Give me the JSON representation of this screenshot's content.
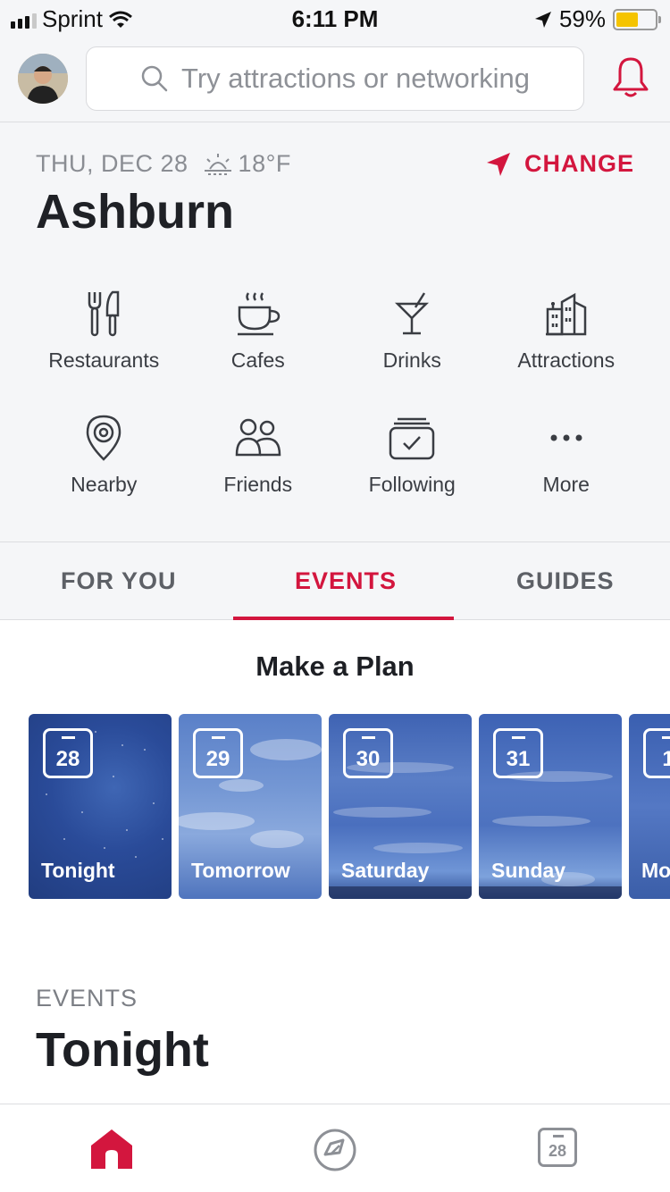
{
  "status_bar": {
    "carrier": "Sprint",
    "time": "6:11 PM",
    "battery": "59%",
    "battery_level": 0.59
  },
  "header": {
    "search_placeholder": "Try attractions or networking"
  },
  "location": {
    "date": "THU, DEC 28",
    "temperature": "18°F",
    "change_label": "CHANGE",
    "city": "Ashburn"
  },
  "categories": [
    {
      "label": "Restaurants",
      "icon": "fork-knife-icon"
    },
    {
      "label": "Cafes",
      "icon": "coffee-cup-icon"
    },
    {
      "label": "Drinks",
      "icon": "cocktail-icon"
    },
    {
      "label": "Attractions",
      "icon": "buildings-icon"
    },
    {
      "label": "Nearby",
      "icon": "location-pin-icon"
    },
    {
      "label": "Friends",
      "icon": "friends-icon"
    },
    {
      "label": "Following",
      "icon": "following-calendar-icon"
    },
    {
      "label": "More",
      "icon": "more-dots-icon"
    }
  ],
  "tabs": [
    {
      "label": "FOR YOU",
      "active": false
    },
    {
      "label": "EVENTS",
      "active": true
    },
    {
      "label": "GUIDES",
      "active": false
    }
  ],
  "plan": {
    "title": "Make a Plan",
    "days": [
      {
        "day": "28",
        "label": "Tonight"
      },
      {
        "day": "29",
        "label": "Tomorrow"
      },
      {
        "day": "30",
        "label": "Saturday"
      },
      {
        "day": "31",
        "label": "Sunday"
      },
      {
        "day": "1",
        "label": "Mo"
      }
    ]
  },
  "events_section": {
    "kicker": "EVENTS",
    "title": "Tonight"
  },
  "bottom_nav": {
    "calendar_day": "28"
  },
  "colors": {
    "accent": "#d3163e",
    "background": "#f5f6f8"
  }
}
